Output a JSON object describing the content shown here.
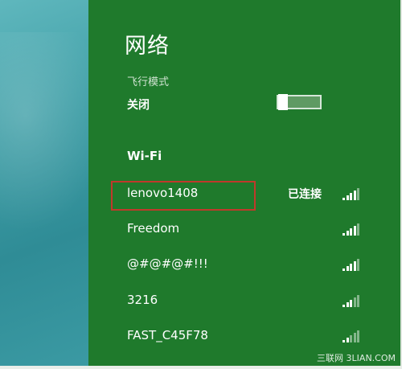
{
  "panel": {
    "title": "网络",
    "airplane_mode": {
      "label": "飞行模式",
      "state": "关闭"
    },
    "wifi_heading": "Wi-Fi",
    "networks": [
      {
        "name": "lenovo1408",
        "status": "已连接",
        "signal_level": 4,
        "signal_max": 5
      },
      {
        "name": "Freedom",
        "status": "",
        "signal_level": 4,
        "signal_max": 5
      },
      {
        "name": "@#@#@#!!!",
        "status": "",
        "signal_level": 4,
        "signal_max": 5
      },
      {
        "name": "3216",
        "status": "",
        "signal_level": 3,
        "signal_max": 5
      },
      {
        "name": "FAST_C45F78",
        "status": "",
        "signal_level": 2,
        "signal_max": 5
      }
    ]
  },
  "watermark": "三联网 3LIAN.COM",
  "colors": {
    "panel_bg": "#1f7a2c",
    "highlight": "#c0392b",
    "desktop": "#3f9ea6"
  }
}
